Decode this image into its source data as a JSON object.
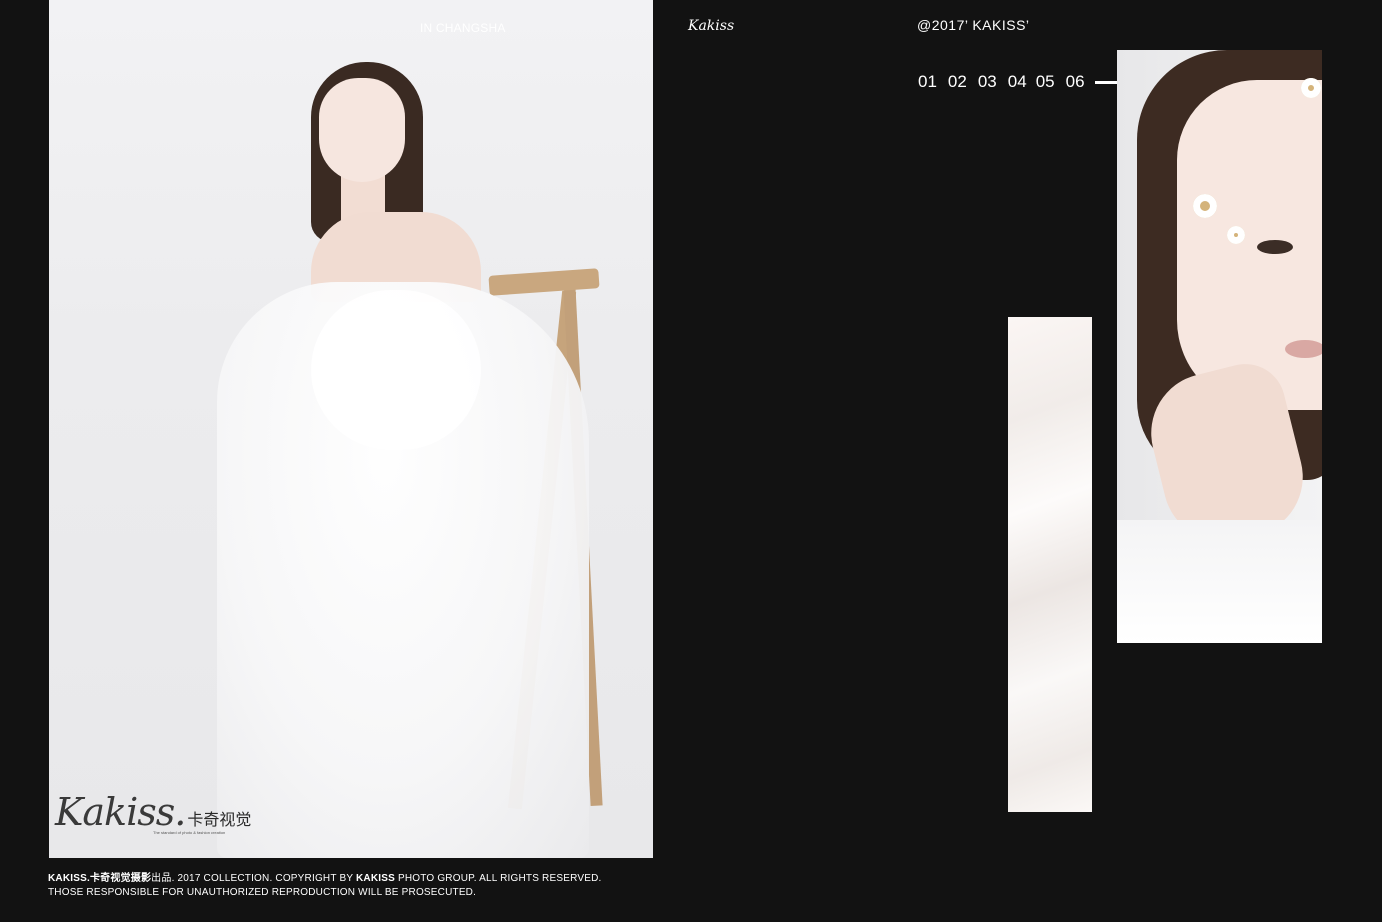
{
  "header": {
    "location": "IN CHANGSHA",
    "brand_script": "Kakiss",
    "copyright": "@2017’ KAKISS’"
  },
  "page_index": {
    "items": [
      "01",
      "02",
      "03",
      "04",
      "05",
      "06"
    ]
  },
  "logo": {
    "script": "Kakiss.",
    "chinese": "卡奇视觉",
    "tagline": "The standard of photo & fashion creation"
  },
  "footer": {
    "brand": "KAKISS.卡奇视觉摄影",
    "line1_rest_a": "出品. 2017 COLLECTION.  COPYRIGHT BY ",
    "line1_brand2": "KAKISS",
    "line1_rest_b": " PHOTO GROUP.  ALL RIGHTS RESERVED.",
    "line2": "THOSE RESPONSIBLE FOR UNAUTHORIZED REPRODUCTION WILL BE PROSECUTED."
  },
  "colors": {
    "background": "#121212",
    "text": "#ffffff"
  }
}
